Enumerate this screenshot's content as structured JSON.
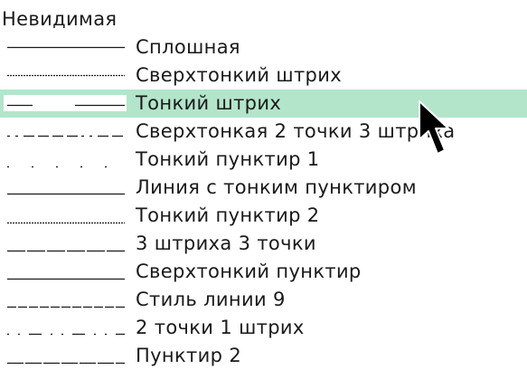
{
  "line_style_list": {
    "selected_index": 3,
    "items": [
      {
        "label": "Невидимая",
        "pattern": "none"
      },
      {
        "label": "Сплошная",
        "pattern": "solid"
      },
      {
        "label": "Сверхтонкий штрих",
        "pattern": "ultrafine-dash"
      },
      {
        "label": "Тонкий штрих",
        "pattern": "fine-dash"
      },
      {
        "label": "Сверхтонкая 2 точки 3 штриха",
        "pattern": "ultrafine-2dots-3dashes"
      },
      {
        "label": "Тонкий пунктир 1",
        "pattern": "fine-dotted-1"
      },
      {
        "label": "Линия с тонким пунктиром",
        "pattern": "line-with-fine-dots"
      },
      {
        "label": "Тонкий пунктир 2",
        "pattern": "fine-dotted-2"
      },
      {
        "label": "3 штриха 3 точки",
        "pattern": "3dashes-3dots"
      },
      {
        "label": "Сверхтонкий пунктир",
        "pattern": "ultrafine-dotted"
      },
      {
        "label": "Стиль линии 9",
        "pattern": "line-style-9"
      },
      {
        "label": "2 точки 1 штрих",
        "pattern": "2dots-1dash"
      },
      {
        "label": "Пунктир 2",
        "pattern": "dashed-2"
      }
    ]
  },
  "colors": {
    "selection": "#b3e5cb",
    "line": "#1a1a1a",
    "text": "#1a1a1a",
    "background": "#ffffff"
  },
  "cursor": {
    "icon": "mouse-pointer-arrow-icon"
  }
}
